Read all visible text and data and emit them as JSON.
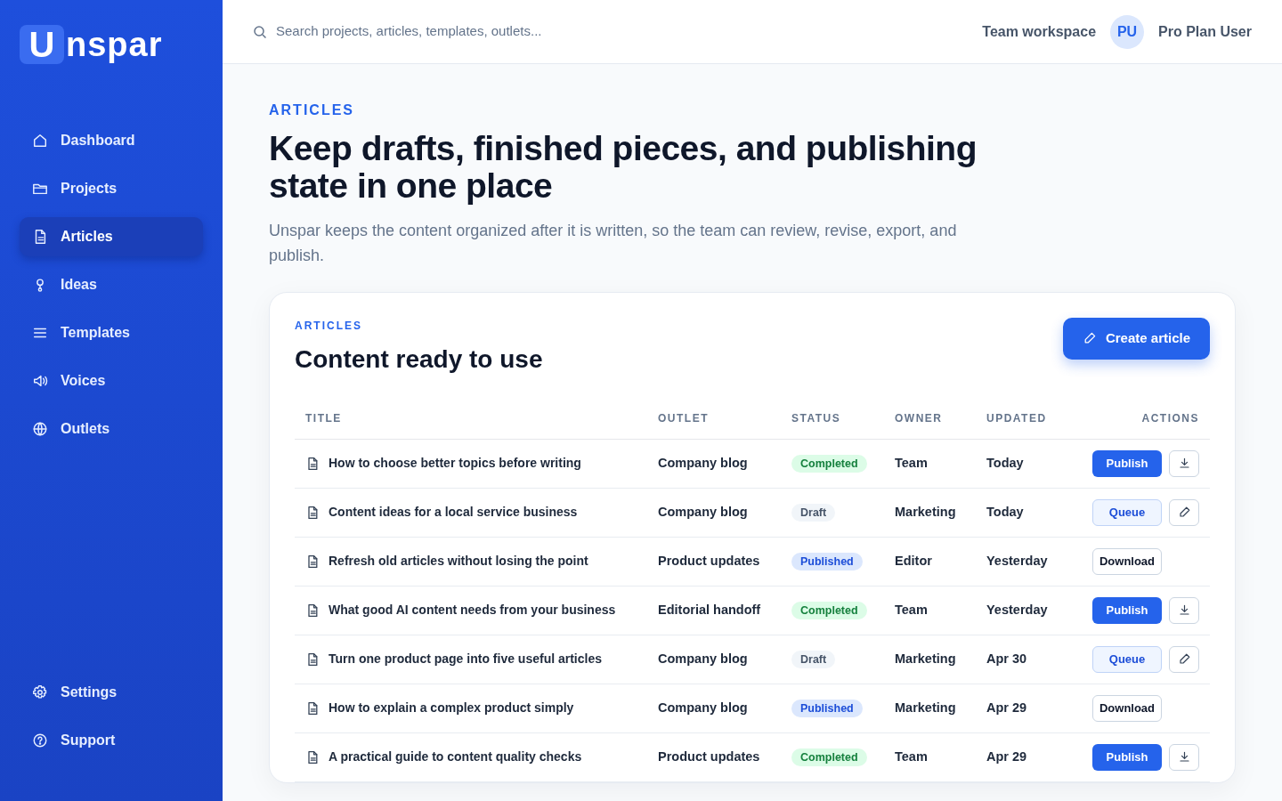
{
  "logo": {
    "mark": "U",
    "text": "nspar"
  },
  "sidebar": {
    "items": [
      {
        "label": "Dashboard",
        "selected": false
      },
      {
        "label": "Projects",
        "selected": false
      },
      {
        "label": "Articles",
        "selected": true
      },
      {
        "label": "Ideas",
        "selected": false
      },
      {
        "label": "Templates",
        "selected": false
      },
      {
        "label": "Voices",
        "selected": false
      },
      {
        "label": "Outlets",
        "selected": false
      }
    ],
    "footer_items": [
      {
        "label": "Settings",
        "selected": false
      },
      {
        "label": "Support",
        "selected": false
      }
    ]
  },
  "topbar": {
    "search": {
      "placeholder": "Search projects, articles, templates, outlets..."
    },
    "workspace": "Team workspace",
    "avatar": "PU",
    "user": "Pro Plan User"
  },
  "header": {
    "eyebrow": "ARTICLES",
    "title": "Keep drafts, finished pieces, and publishing state in one place",
    "subtitle": "Unspar keeps the content organized after it is written, so the team can review, revise, export, and publish."
  },
  "card": {
    "eyebrow": "ARTICLES",
    "title": "Content ready to use",
    "create_button": "Create article"
  },
  "table": {
    "columns": [
      "TITLE",
      "OUTLET",
      "STATUS",
      "OWNER",
      "UPDATED",
      "ACTIONS"
    ],
    "rows": [
      {
        "title": "How to choose better topics before writing",
        "outlet": "Company blog",
        "status": {
          "label": "Completed",
          "kind": "completed"
        },
        "owner": "Team",
        "updated": "Today",
        "action": {
          "label": "Publish",
          "kind": "primary"
        },
        "icon_button": {
          "kind": "download"
        }
      },
      {
        "title": "Content ideas for a local service business",
        "outlet": "Company blog",
        "status": {
          "label": "Draft",
          "kind": "draft"
        },
        "owner": "Marketing",
        "updated": "Today",
        "action": {
          "label": "Queue",
          "kind": "soft"
        },
        "icon_button": {
          "kind": "edit"
        }
      },
      {
        "title": "Refresh old articles without losing the point",
        "outlet": "Product updates",
        "status": {
          "label": "Published",
          "kind": "published"
        },
        "owner": "Editor",
        "updated": "Yesterday",
        "action": {
          "label": "Download",
          "kind": "outline"
        }
      },
      {
        "title": "What good AI content needs from your business",
        "outlet": "Editorial handoff",
        "status": {
          "label": "Completed",
          "kind": "completed"
        },
        "owner": "Team",
        "updated": "Yesterday",
        "action": {
          "label": "Publish",
          "kind": "primary"
        },
        "icon_button": {
          "kind": "download"
        }
      },
      {
        "title": "Turn one product page into five useful articles",
        "outlet": "Company blog",
        "status": {
          "label": "Draft",
          "kind": "draft"
        },
        "owner": "Marketing",
        "updated": "Apr 30",
        "action": {
          "label": "Queue",
          "kind": "soft"
        },
        "icon_button": {
          "kind": "edit"
        }
      },
      {
        "title": "How to explain a complex product simply",
        "outlet": "Company blog",
        "status": {
          "label": "Published",
          "kind": "published"
        },
        "owner": "Marketing",
        "updated": "Apr 29",
        "action": {
          "label": "Download",
          "kind": "outline"
        }
      },
      {
        "title": "A practical guide to content quality checks",
        "outlet": "Product updates",
        "status": {
          "label": "Completed",
          "kind": "completed"
        },
        "owner": "Team",
        "updated": "Apr 29",
        "action": {
          "label": "Publish",
          "kind": "primary"
        },
        "icon_button": {
          "kind": "download"
        }
      }
    ]
  }
}
